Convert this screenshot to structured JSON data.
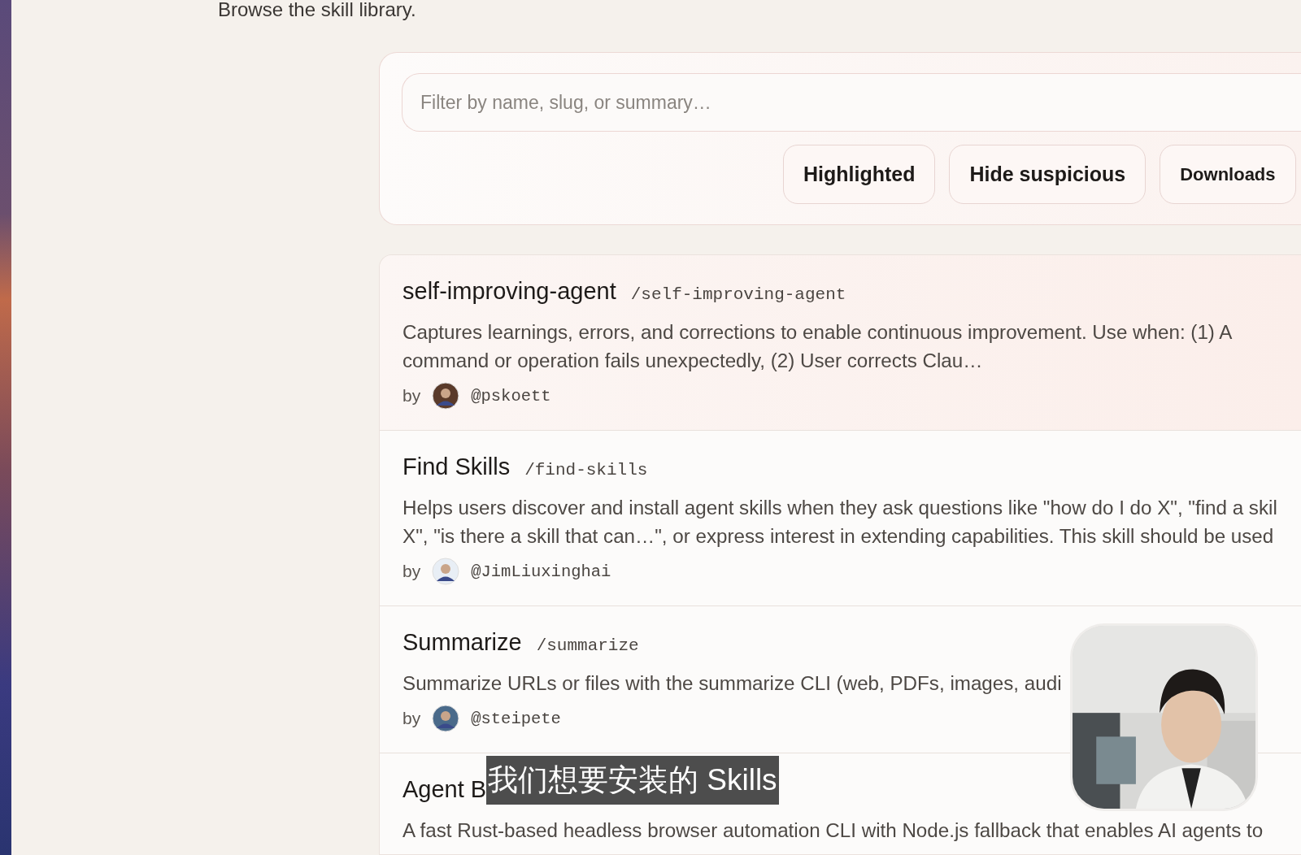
{
  "intro": "Browse the skill library.",
  "filter": {
    "placeholder": "Filter by name, slug, or summary…",
    "buttons": [
      {
        "label": "Highlighted"
      },
      {
        "label": "Hide suspicious"
      },
      {
        "label": "Downloads"
      }
    ]
  },
  "skills": [
    {
      "name": "self-improving-agent",
      "slug": "/self-improving-agent",
      "summary": [
        "Captures learnings, errors, and corrections to enable continuous improvement. Use when: (1) A",
        "command or operation fails unexpectedly, (2) User corrects Clau…"
      ],
      "by": "by",
      "author": "@pskoett",
      "selected": true
    },
    {
      "name": "Find Skills",
      "slug": "/find-skills",
      "summary": [
        "Helps users discover and install agent skills when they ask questions like \"how do I do X\", \"find a skil",
        "X\", \"is there a skill that can…\", or express interest in extending capabilities. This skill should be used"
      ],
      "by": "by",
      "author": "@JimLiuxinghai",
      "selected": false
    },
    {
      "name": "Summarize",
      "slug": "/summarize",
      "summary": [
        "Summarize URLs or files with the summarize CLI (web, PDFs, images, audi"
      ],
      "by": "by",
      "author": "@steipete",
      "selected": false
    },
    {
      "name": "Agent B",
      "summary": [
        "A fast Rust-based headless browser automation CLI with Node.js fallback that enables AI agents to"
      ],
      "selected": false
    }
  ],
  "subtitle": "我们想要安装的 Skills"
}
